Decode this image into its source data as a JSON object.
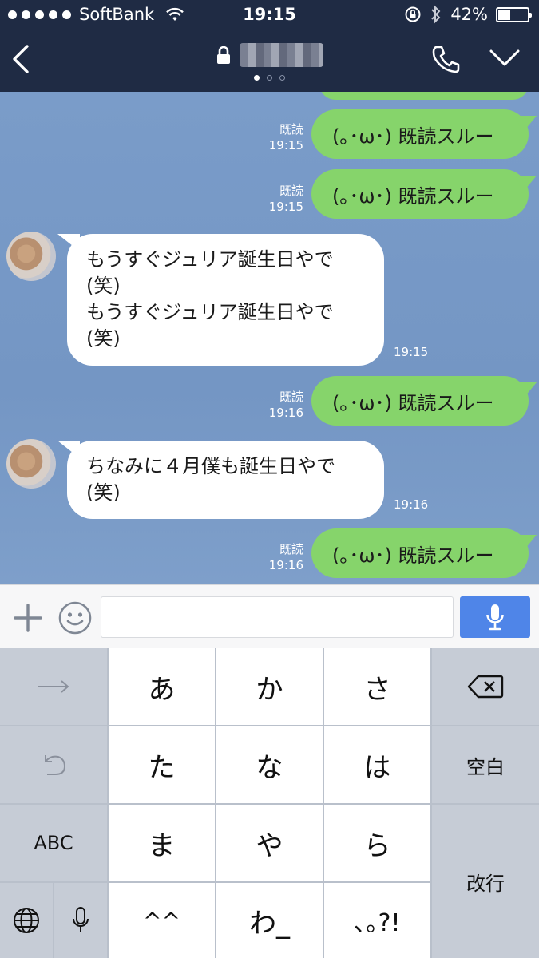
{
  "status_bar": {
    "carrier": "SoftBank",
    "time": "19:15",
    "battery": "42%",
    "battery_level": 0.42
  },
  "header": {
    "page_count": 3,
    "active_page": 0
  },
  "messages": [
    {
      "side": "right",
      "text": "(｡･ω･) 既読スルー",
      "read": "既読",
      "time": "19:15"
    },
    {
      "side": "right",
      "text": "(｡･ω･) 既読スルー",
      "read": "既読",
      "time": "19:15"
    },
    {
      "side": "left",
      "lines": [
        "もうすぐジュリア誕生日やで",
        "(笑)",
        "もうすぐジュリア誕生日やで",
        "(笑)"
      ],
      "time": "19:15"
    },
    {
      "side": "right",
      "text": "(｡･ω･) 既読スルー",
      "read": "既読",
      "time": "19:16"
    },
    {
      "side": "left",
      "lines": [
        "ちなみに４月僕も誕生日やで",
        "(笑)"
      ],
      "time": "19:16"
    },
    {
      "side": "right",
      "text": "(｡･ω･) 既読スルー",
      "read": "既読",
      "time": "19:16"
    }
  ],
  "input": {
    "value": "",
    "placeholder": ""
  },
  "keyboard": {
    "row1": [
      "→",
      "あ",
      "か",
      "さ",
      "⌫"
    ],
    "row2": [
      "↶",
      "た",
      "な",
      "は",
      "空白"
    ],
    "row3": [
      "ABC",
      "ま",
      "や",
      "ら",
      "改行"
    ],
    "row4": [
      "globe",
      "mic",
      "^^",
      "わ_",
      "､｡?!"
    ]
  },
  "colors": {
    "header_bg": "#1f2b44",
    "chat_bg": "#7a9cc8",
    "sent_bubble": "#86d46b",
    "received_bubble": "#ffffff",
    "mic_button": "#4f85e8"
  }
}
